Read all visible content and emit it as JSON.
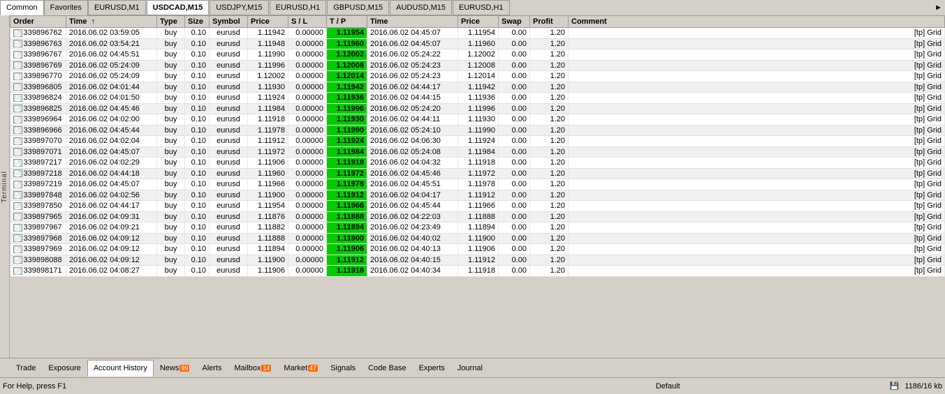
{
  "topTabs": [
    {
      "label": "Common",
      "active": true
    },
    {
      "label": "Favorites",
      "active": false
    }
  ],
  "chartTabs": [
    {
      "label": "EURUSD,M1",
      "active": false
    },
    {
      "label": "USDCAD,M15",
      "active": true
    },
    {
      "label": "USDJPY,M15",
      "active": false
    },
    {
      "label": "EURUSD,H1",
      "active": false
    },
    {
      "label": "GBPUSD,M15",
      "active": false
    },
    {
      "label": "AUDUSD,M15",
      "active": false
    },
    {
      "label": "EURUSD,H1",
      "active": false
    }
  ],
  "tableHeaders": {
    "order": "Order",
    "time1": "Time",
    "type": "Type",
    "size": "Size",
    "symbol": "Symbol",
    "price": "Price",
    "sl": "S / L",
    "tp": "T / P",
    "time2": "Time",
    "price2": "Price",
    "swap": "Swap",
    "profit": "Profit",
    "comment": "Comment"
  },
  "rows": [
    {
      "order": "339896762",
      "time1": "2016.06.02 03:59:05",
      "type": "buy",
      "size": "0.10",
      "symbol": "eurusd",
      "price": "1.11942",
      "sl": "0.00000",
      "tp": "1.11954",
      "time2": "2016.06.02 04:45:07",
      "price2": "1.11954",
      "swap": "0.00",
      "profit": "1.20",
      "comment": "[tp] Grid",
      "tpHighlight": true
    },
    {
      "order": "339896763",
      "time1": "2016.06.02 03:54:21",
      "type": "buy",
      "size": "0.10",
      "symbol": "eurusd",
      "price": "1.11948",
      "sl": "0.00000",
      "tp": "1.11960",
      "time2": "2016.06.02 04:45:07",
      "price2": "1.11960",
      "swap": "0.00",
      "profit": "1.20",
      "comment": "[tp] Grid",
      "tpHighlight": true
    },
    {
      "order": "339896767",
      "time1": "2016.06.02 04:45:51",
      "type": "buy",
      "size": "0.10",
      "symbol": "eurusd",
      "price": "1.11990",
      "sl": "0.00000",
      "tp": "1.12002",
      "time2": "2016.06.02 05:24:22",
      "price2": "1.12002",
      "swap": "0.00",
      "profit": "1.20",
      "comment": "[tp] Grid",
      "tpHighlight": true
    },
    {
      "order": "339896769",
      "time1": "2016.06.02 05:24:09",
      "type": "buy",
      "size": "0.10",
      "symbol": "eurusd",
      "price": "1.11996",
      "sl": "0.00000",
      "tp": "1.12008",
      "time2": "2016.06.02 05:24:23",
      "price2": "1.12008",
      "swap": "0.00",
      "profit": "1.20",
      "comment": "[tp] Grid",
      "tpHighlight": true
    },
    {
      "order": "339896770",
      "time1": "2016.06.02 05:24:09",
      "type": "buy",
      "size": "0.10",
      "symbol": "eurusd",
      "price": "1.12002",
      "sl": "0.00000",
      "tp": "1.12014",
      "time2": "2016.06.02 05:24:23",
      "price2": "1.12014",
      "swap": "0.00",
      "profit": "1.20",
      "comment": "[tp] Grid",
      "tpHighlight": true
    },
    {
      "order": "339896805",
      "time1": "2016.06.02 04:01:44",
      "type": "buy",
      "size": "0.10",
      "symbol": "eurusd",
      "price": "1.11930",
      "sl": "0.00000",
      "tp": "1.11942",
      "time2": "2016.06.02 04:44:17",
      "price2": "1.11942",
      "swap": "0.00",
      "profit": "1.20",
      "comment": "[tp] Grid",
      "tpHighlight": true
    },
    {
      "order": "339896824",
      "time1": "2016.06.02 04:01:50",
      "type": "buy",
      "size": "0.10",
      "symbol": "eurusd",
      "price": "1.11924",
      "sl": "0.00000",
      "tp": "1.11936",
      "time2": "2016.06.02 04:44:15",
      "price2": "1.11936",
      "swap": "0.00",
      "profit": "1.20",
      "comment": "[tp] Grid",
      "tpHighlight": true
    },
    {
      "order": "339896825",
      "time1": "2016.06.02 04:45:46",
      "type": "buy",
      "size": "0.10",
      "symbol": "eurusd",
      "price": "1.11984",
      "sl": "0.00000",
      "tp": "1.11996",
      "time2": "2016.06.02 05:24:20",
      "price2": "1.11996",
      "swap": "0.00",
      "profit": "1.20",
      "comment": "[tp] Grid",
      "tpHighlight": true
    },
    {
      "order": "339896964",
      "time1": "2016.06.02 04:02:00",
      "type": "buy",
      "size": "0.10",
      "symbol": "eurusd",
      "price": "1.11918",
      "sl": "0.00000",
      "tp": "1.11930",
      "time2": "2016.06.02 04:44:11",
      "price2": "1.11930",
      "swap": "0.00",
      "profit": "1.20",
      "comment": "[tp] Grid",
      "tpHighlight": true
    },
    {
      "order": "339896966",
      "time1": "2016.06.02 04:45:44",
      "type": "buy",
      "size": "0.10",
      "symbol": "eurusd",
      "price": "1.11978",
      "sl": "0.00000",
      "tp": "1.11990",
      "time2": "2016.06.02 05:24:10",
      "price2": "1.11990",
      "swap": "0.00",
      "profit": "1.20",
      "comment": "[tp] Grid",
      "tpHighlight": true
    },
    {
      "order": "339897070",
      "time1": "2016.06.02 04:02:04",
      "type": "buy",
      "size": "0.10",
      "symbol": "eurusd",
      "price": "1.11912",
      "sl": "0.00000",
      "tp": "1.11924",
      "time2": "2016.06.02 04:06:30",
      "price2": "1.11924",
      "swap": "0.00",
      "profit": "1.20",
      "comment": "[tp] Grid",
      "tpHighlight": true
    },
    {
      "order": "339897071",
      "time1": "2016.06.02 04:45:07",
      "type": "buy",
      "size": "0.10",
      "symbol": "eurusd",
      "price": "1.11972",
      "sl": "0.00000",
      "tp": "1.11984",
      "time2": "2016.06.02 05:24:08",
      "price2": "1.11984",
      "swap": "0.00",
      "profit": "1.20",
      "comment": "[tp] Grid",
      "tpHighlight": true
    },
    {
      "order": "339897217",
      "time1": "2016.06.02 04:02:29",
      "type": "buy",
      "size": "0.10",
      "symbol": "eurusd",
      "price": "1.11906",
      "sl": "0.00000",
      "tp": "1.11918",
      "time2": "2016.06.02 04:04:32",
      "price2": "1.11918",
      "swap": "0.00",
      "profit": "1.20",
      "comment": "[tp] Grid",
      "tpHighlight": true
    },
    {
      "order": "339897218",
      "time1": "2016.06.02 04:44:18",
      "type": "buy",
      "size": "0.10",
      "symbol": "eurusd",
      "price": "1.11960",
      "sl": "0.00000",
      "tp": "1.11972",
      "time2": "2016.06.02 04:45:46",
      "price2": "1.11972",
      "swap": "0.00",
      "profit": "1.20",
      "comment": "[tp] Grid",
      "tpHighlight": true
    },
    {
      "order": "339897219",
      "time1": "2016.06.02 04:45:07",
      "type": "buy",
      "size": "0.10",
      "symbol": "eurusd",
      "price": "1.11966",
      "sl": "0.00000",
      "tp": "1.11978",
      "time2": "2016.06.02 04:45:51",
      "price2": "1.11978",
      "swap": "0.00",
      "profit": "1.20",
      "comment": "[tp] Grid",
      "tpHighlight": true
    },
    {
      "order": "339897848",
      "time1": "2016.06.02 04:02:56",
      "type": "buy",
      "size": "0.10",
      "symbol": "eurusd",
      "price": "1.11900",
      "sl": "0.00000",
      "tp": "1.11912",
      "time2": "2016.06.02 04:04:17",
      "price2": "1.11912",
      "swap": "0.00",
      "profit": "1.20",
      "comment": "[tp] Grid",
      "tpHighlight": true
    },
    {
      "order": "339897850",
      "time1": "2016.06.02 04:44:17",
      "type": "buy",
      "size": "0.10",
      "symbol": "eurusd",
      "price": "1.11954",
      "sl": "0.00000",
      "tp": "1.11966",
      "time2": "2016.06.02 04:45:44",
      "price2": "1.11966",
      "swap": "0.00",
      "profit": "1.20",
      "comment": "[tp] Grid",
      "tpHighlight": true
    },
    {
      "order": "339897965",
      "time1": "2016.06.02 04:09:31",
      "type": "buy",
      "size": "0.10",
      "symbol": "eurusd",
      "price": "1.11876",
      "sl": "0.00000",
      "tp": "1.11888",
      "time2": "2016.06.02 04:22:03",
      "price2": "1.11888",
      "swap": "0.00",
      "profit": "1.20",
      "comment": "[tp] Grid",
      "tpHighlight": true
    },
    {
      "order": "339897967",
      "time1": "2016.06.02 04:09:21",
      "type": "buy",
      "size": "0.10",
      "symbol": "eurusd",
      "price": "1.11882",
      "sl": "0.00000",
      "tp": "1.11894",
      "time2": "2016.06.02 04:23:49",
      "price2": "1.11894",
      "swap": "0.00",
      "profit": "1.20",
      "comment": "[tp] Grid",
      "tpHighlight": true
    },
    {
      "order": "339897968",
      "time1": "2016.06.02 04:09:12",
      "type": "buy",
      "size": "0.10",
      "symbol": "eurusd",
      "price": "1.11888",
      "sl": "0.00000",
      "tp": "1.11900",
      "time2": "2016.06.02 04:40:02",
      "price2": "1.11900",
      "swap": "0.00",
      "profit": "1.20",
      "comment": "[tp] Grid",
      "tpHighlight": true
    },
    {
      "order": "339897969",
      "time1": "2016.06.02 04:09:12",
      "type": "buy",
      "size": "0.10",
      "symbol": "eurusd",
      "price": "1.11894",
      "sl": "0.00000",
      "tp": "1.11906",
      "time2": "2016.06.02 04:40:13",
      "price2": "1.11906",
      "swap": "0.00",
      "profit": "1.20",
      "comment": "[tp] Grid",
      "tpHighlight": true
    },
    {
      "order": "339898088",
      "time1": "2016.06.02 04:09:12",
      "type": "buy",
      "size": "0.10",
      "symbol": "eurusd",
      "price": "1.11900",
      "sl": "0.00000",
      "tp": "1.11912",
      "time2": "2016.06.02 04:40:15",
      "price2": "1.11912",
      "swap": "0.00",
      "profit": "1.20",
      "comment": "[tp] Grid",
      "tpHighlight": true
    },
    {
      "order": "339898171",
      "time1": "2016.06.02 04:08:27",
      "type": "buy",
      "size": "0.10",
      "symbol": "eurusd",
      "price": "1.11906",
      "sl": "0.00000",
      "tp": "1.11918",
      "time2": "2016.06.02 04:40:34",
      "price2": "1.11918",
      "swap": "0.00",
      "profit": "1.20",
      "comment": "[tp] Grid",
      "tpHighlight": true
    }
  ],
  "bottomTabs": [
    {
      "label": "Trade",
      "active": false,
      "badge": null
    },
    {
      "label": "Exposure",
      "active": false,
      "badge": null
    },
    {
      "label": "Account History",
      "active": true,
      "badge": null
    },
    {
      "label": "News",
      "active": false,
      "badge": "99"
    },
    {
      "label": "Alerts",
      "active": false,
      "badge": null
    },
    {
      "label": "Mailbox",
      "active": false,
      "badge": "14"
    },
    {
      "label": "Market",
      "active": false,
      "badge": "47"
    },
    {
      "label": "Signals",
      "active": false,
      "badge": null
    },
    {
      "label": "Code Base",
      "active": false,
      "badge": null
    },
    {
      "label": "Experts",
      "active": false,
      "badge": null
    },
    {
      "label": "Journal",
      "active": false,
      "badge": null
    }
  ],
  "statusBar": {
    "left": "For Help, press F1",
    "center": "Default",
    "right": "1186/16 kb"
  },
  "sidebarLabel": "Terminal"
}
